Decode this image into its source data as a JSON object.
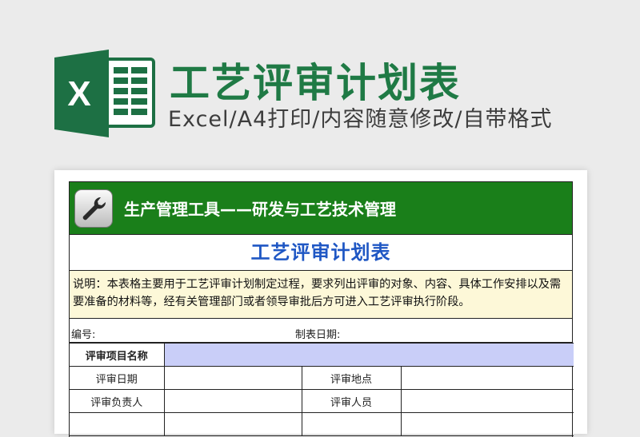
{
  "header": {
    "title": "工艺评审计划表",
    "subtitle": "Excel/A4打印/内容随意修改/自带格式"
  },
  "logo": {
    "letter": "X",
    "color": "#1d7044"
  },
  "sheet": {
    "banner_text": "生产管理工具——研发与工艺技术管理",
    "banner_color": "#1a7f1a",
    "banner_icon": "wrench-icon",
    "title": "工艺评审计划表",
    "description": "说明：本表格主要用于工艺评审计划制定过程，要求列出评审的对象、内容、具体工作安排以及需要准备的材料等，经有关管理部门或者领导审批后方可进入工艺评审执行阶段。",
    "number_label": "编号:",
    "date_label": "制表日期:",
    "rows": {
      "project_name_label": "评审项目名称",
      "date_label": "评审日期",
      "location_label": "评审地点",
      "responsible_label": "评审负责人",
      "personnel_label": "评审人员"
    }
  }
}
